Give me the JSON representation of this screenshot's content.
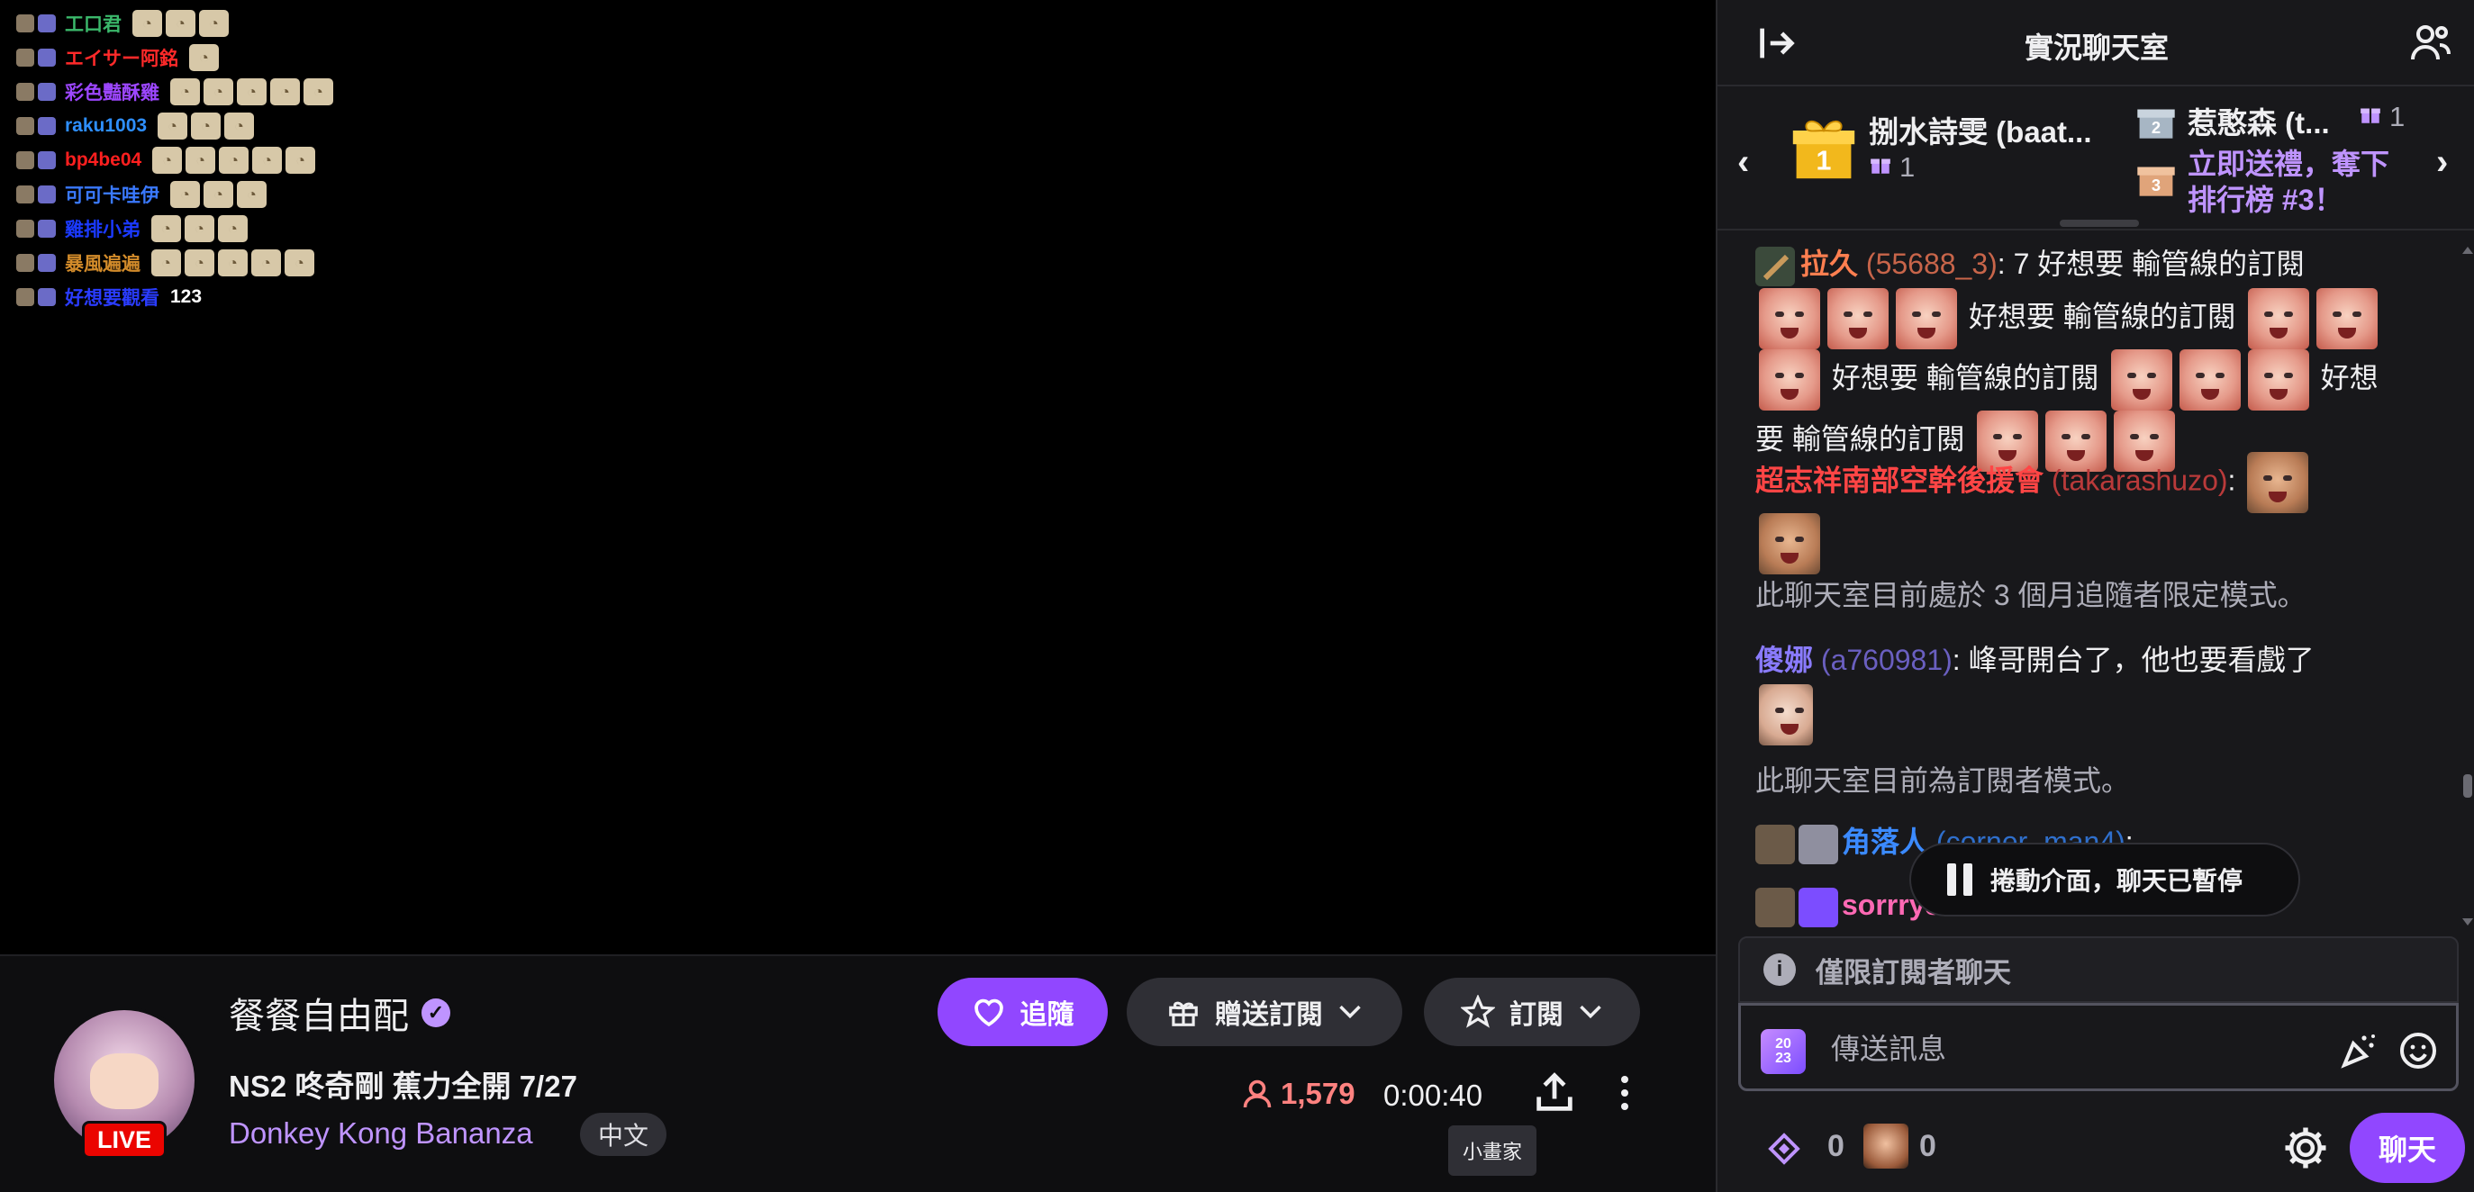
{
  "overlay_chat": [
    {
      "name": "工口君",
      "color": "#3bb86b",
      "emotes": 3,
      "text": ""
    },
    {
      "name": "エイサー阿銘",
      "color": "#ff2a2a",
      "emotes": 1,
      "text": ""
    },
    {
      "name": "彩色豔酥雞",
      "color": "#9d47ff",
      "emotes": 5,
      "text": ""
    },
    {
      "name": "raku1003",
      "color": "#2e8fff",
      "emotes": 3,
      "text": ""
    },
    {
      "name": "bp4be04",
      "color": "#ff1f1f",
      "emotes": 5,
      "text": ""
    },
    {
      "name": "可可卡哇伊",
      "color": "#3a79ff",
      "emotes": 3,
      "text": ""
    },
    {
      "name": "雞排小弟",
      "color": "#1b3aff",
      "emotes": 3,
      "text": ""
    },
    {
      "name": "暴風遍遍",
      "color": "#d28b2a",
      "emotes": 5,
      "text": ""
    },
    {
      "name": "好想要觀看",
      "color": "#2a3cff",
      "emotes": 0,
      "text": "123"
    }
  ],
  "stream": {
    "streamer": "餐餐自由配",
    "live_label": "LIVE",
    "title": "NS2 咚奇剛 蕉力全開 7/27",
    "category": "Donkey Kong Bananza",
    "language": "中文",
    "viewers": "1,579",
    "uptime": "0:00:40",
    "tooltip": "小畫家"
  },
  "buttons": {
    "follow": "追隨",
    "gift_sub": "贈送訂閱",
    "subscribe": "訂閱"
  },
  "chat": {
    "title": "實況聊天室",
    "leaderboard": {
      "first_name": "捌水詩雯 (baat...",
      "first_count": "1",
      "second_name": "惹憨森 (t...",
      "second_count": "1",
      "third_cta": "立即送禮，奪下排行榜 #3！"
    },
    "messages": {
      "m1_user": "拉久",
      "m1_login": "(55688_3)",
      "m1_text_a": ": 7 好想要 輸管線的訂閱",
      "m1_text_b": "好想要 輸管線的訂閱",
      "m1_text_c": "好想要 輸管線的訂閱",
      "m1_text_d": "好想",
      "m1_text_e": "要 輸管線的訂閱",
      "m2_user": "超志祥南部空幹後援會",
      "m2_login": "(takarashuzo)",
      "sys1": "此聊天室目前處於 3 個月追隨者限定模式。",
      "m3_user": "傻娜",
      "m3_login": "(a760981)",
      "m3_text": ": 峰哥開台了，他也要看戲了",
      "sys2": "此聊天室目前為訂閱者模式。",
      "m4_user": "角落人",
      "m4_login": "(corner_man4)",
      "m5_user": "sorrry30000",
      "colon": ":"
    },
    "paused": "捲動介面，聊天已暫停",
    "sub_only": "僅限訂閱者聊天",
    "input_placeholder": "傳送訊息",
    "badge_text_top": "20",
    "badge_text_bottom": "23",
    "points": "0",
    "predictions": "0",
    "send": "聊天"
  },
  "colors": {
    "accent": "#9147ff",
    "m1_user": "#ff7f50",
    "m2_user": "#ff4545",
    "m3_user": "#8a7bff",
    "m4_user": "#3b8aff",
    "m5_user": "#ff69b4"
  }
}
